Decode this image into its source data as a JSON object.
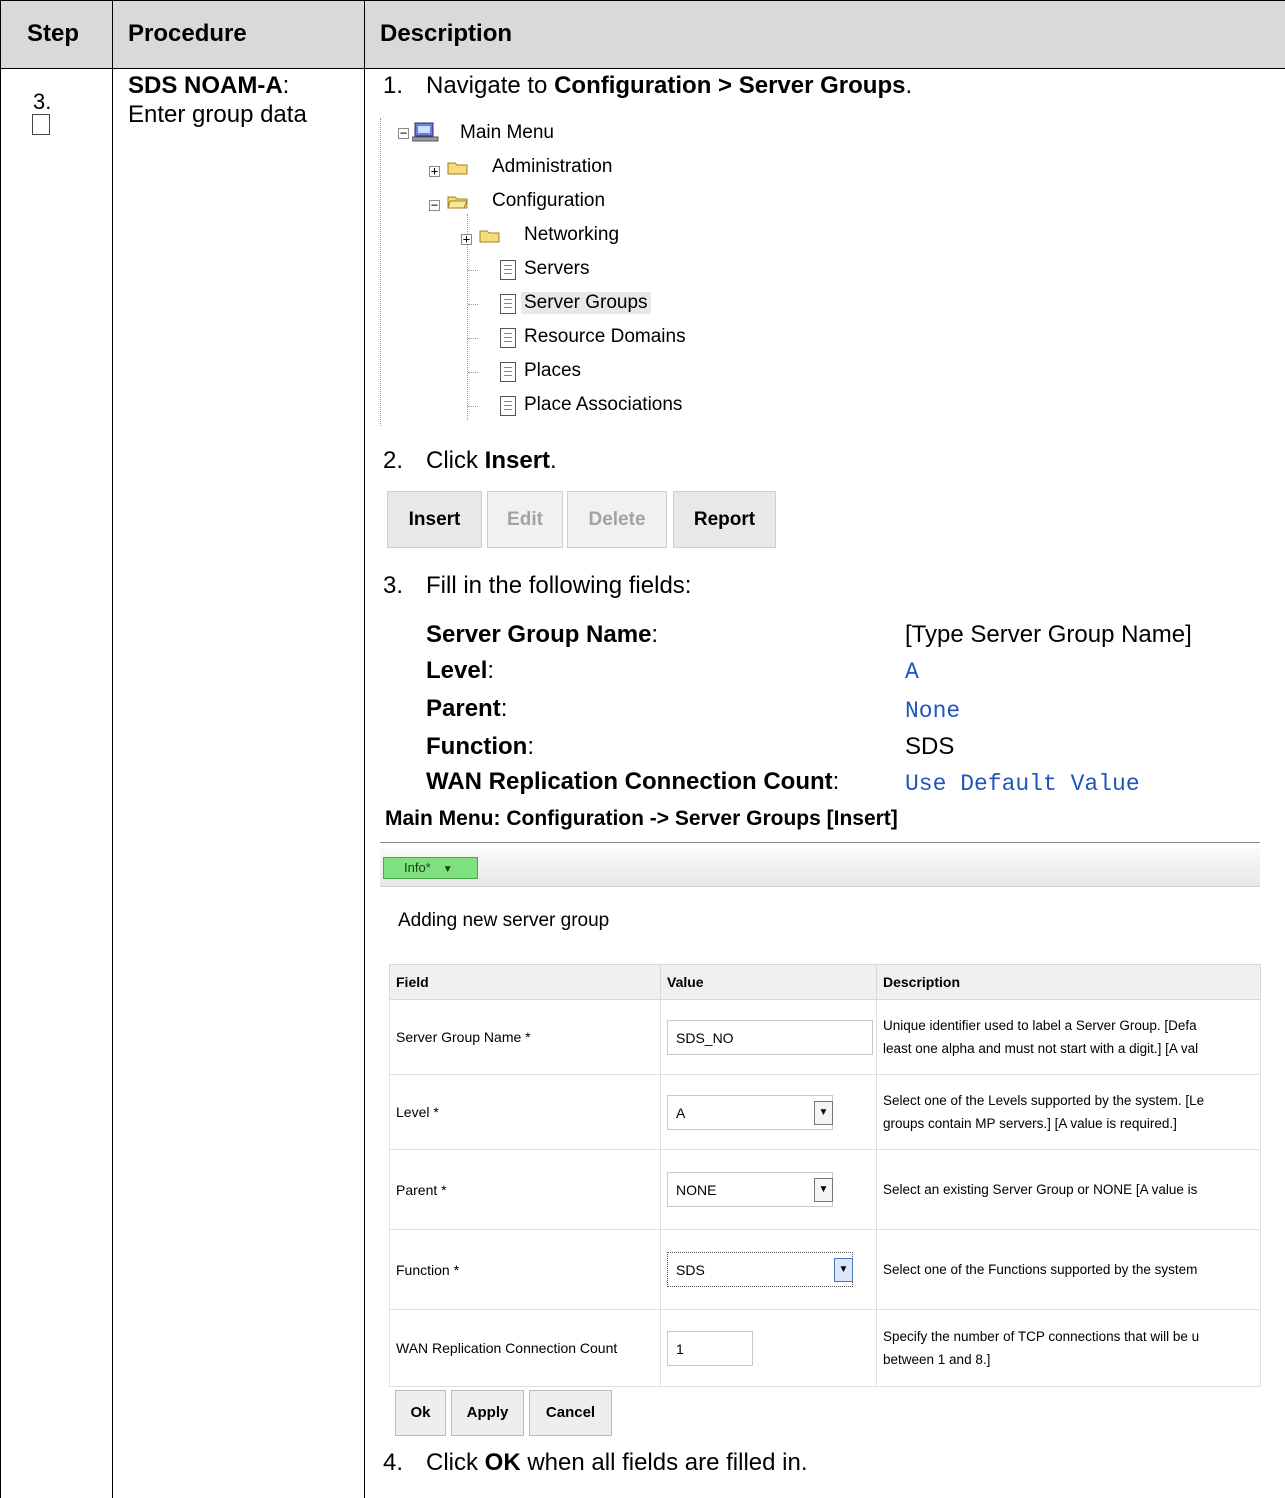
{
  "table": {
    "headers": [
      "Step",
      "Procedure",
      "Description"
    ],
    "step_number": "3.",
    "procedure_title": "SDS NOAM-A",
    "procedure_colon": ":",
    "procedure_sub": "Enter group data"
  },
  "steps": {
    "s1_num": "1.",
    "s1_text": "Navigate to ",
    "s1_bold": "Configuration > Server Groups",
    "s1_end": ".",
    "s2_num": "2.",
    "s2_text": "Click ",
    "s2_bold": "Insert",
    "s2_end": ".",
    "s3_num": "3.",
    "s3_text": "Fill in the following fields:",
    "s4_num": "4.",
    "s4_text": "Click ",
    "s4_bold": "OK",
    "s4_end": " when all fields are filled in."
  },
  "tree": {
    "items": [
      "Main Menu",
      "Administration",
      "Configuration",
      "Networking",
      "Servers",
      "Server Groups",
      "Resource Domains",
      "Places",
      "Place Associations"
    ],
    "plus": "+",
    "minus": "−"
  },
  "toolbar": {
    "insert": "Insert",
    "edit": "Edit",
    "delete": "Delete",
    "report": "Report"
  },
  "fields_list": [
    {
      "label": "Server Group Name",
      "colon": ":",
      "value": "[Type Server Group Name]"
    },
    {
      "label": "Level",
      "colon": ":",
      "value": "A"
    },
    {
      "label": "Parent",
      "colon": ":",
      "value": "None"
    },
    {
      "label": "Function",
      "colon": ":",
      "value": "SDS"
    },
    {
      "label": "WAN Replication Connection Count",
      "colon": ":",
      "value": "Use Default Value"
    }
  ],
  "form": {
    "title": "Main Menu: Configuration -> Server Groups [Insert]",
    "info_label": "Info*",
    "info_arrow": "▼",
    "heading": "Adding new server group",
    "col_field": "Field",
    "col_value": "Value",
    "col_desc": "Description",
    "rows": [
      {
        "field": "Server Group Name *",
        "value": "SDS_NO",
        "desc1": "Unique identifier used to label a Server Group. [Defa",
        "desc2": "least one alpha and must not start with a digit.] [A val"
      },
      {
        "field": "Level *",
        "value": "A",
        "desc1": "Select one of the Levels supported by the system. [Le",
        "desc2": "groups contain MP servers.] [A value is required.]"
      },
      {
        "field": "Parent *",
        "value": "NONE",
        "desc1": "Select an existing Server Group or NONE [A value is",
        "desc2": ""
      },
      {
        "field": "Function *",
        "value": "SDS",
        "desc1": "Select one of the Functions supported by the system",
        "desc2": ""
      },
      {
        "field": "WAN Replication Connection Count",
        "value": "1",
        "desc1": "Specify the number of TCP connections that will be u",
        "desc2": "between 1 and 8.]"
      }
    ],
    "select_arrow": "▼",
    "ok": "Ok",
    "apply": "Apply",
    "cancel": "Cancel"
  }
}
